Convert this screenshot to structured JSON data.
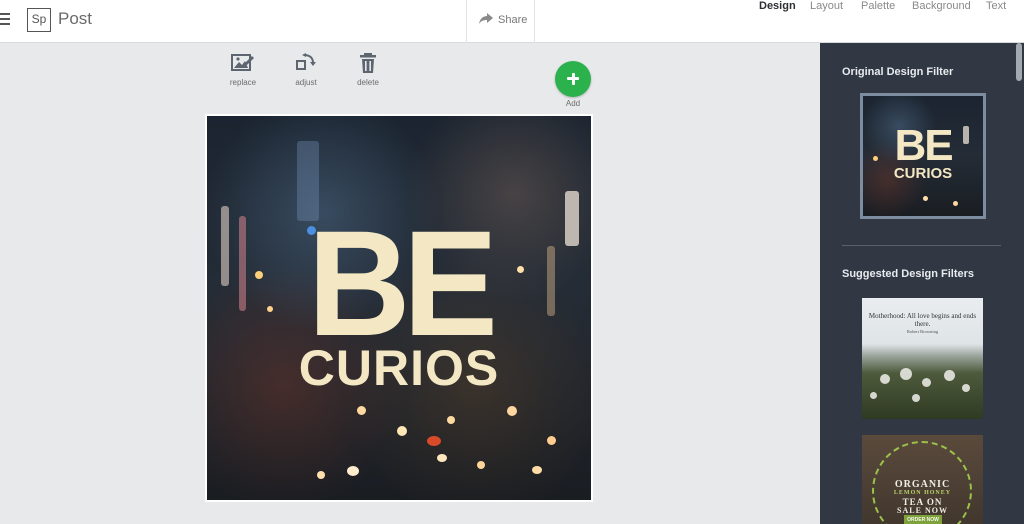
{
  "app": {
    "logo_text": "Sp",
    "title": "Post"
  },
  "header": {
    "share_label": "Share",
    "tabs": [
      {
        "label": "Design",
        "active": true
      },
      {
        "label": "Layout",
        "active": false
      },
      {
        "label": "Palette",
        "active": false
      },
      {
        "label": "Background",
        "active": false
      },
      {
        "label": "Text",
        "active": false
      }
    ]
  },
  "toolbar": {
    "replace_label": "replace",
    "adjust_label": "adjust",
    "delete_label": "delete",
    "add_label": "Add"
  },
  "canvas": {
    "headline": "BE",
    "subline": "CURIOS"
  },
  "panel": {
    "original_heading": "Original Design Filter",
    "original_thumb": {
      "headline": "BE",
      "subline": "CURIOS"
    },
    "suggested_heading": "Suggested Design Filters",
    "suggested": [
      {
        "quote": "Motherhood: All love begins and ends there.",
        "author": "Robert Browning"
      },
      {
        "line1": "ORGANIC",
        "line2": "LEMON HONEY",
        "line3": "TEA ON",
        "line4": "SALE NOW",
        "button": "ORDER NOW"
      }
    ]
  },
  "colors": {
    "accent_add": "#2bb24c",
    "panel_bg": "#313843",
    "headline_color": "#f3e7c4"
  }
}
